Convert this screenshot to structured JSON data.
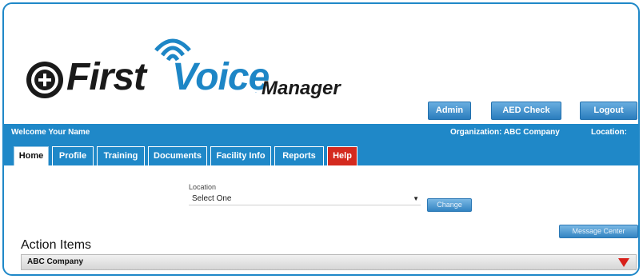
{
  "logo": {
    "first": "First",
    "voice": "Voice",
    "tm": ".",
    "manager": "Manager"
  },
  "header_buttons": {
    "admin": "Admin",
    "aed_check": "AED Check",
    "logout": "Logout"
  },
  "status_bar": {
    "welcome": "Welcome Your Name",
    "organization": "Organization: ABC Company",
    "location": "Location: All"
  },
  "tabs": [
    {
      "label": "Home"
    },
    {
      "label": "Profile"
    },
    {
      "label": "Training"
    },
    {
      "label": "Documents"
    },
    {
      "label": "Facility Info"
    },
    {
      "label": "Reports"
    },
    {
      "label": "Help"
    }
  ],
  "location_filter": {
    "label": "Location",
    "selected": "Select One",
    "change_button": "Change"
  },
  "message_center_button": "Message Center",
  "action_items": {
    "title": "Action Items",
    "company": "ABC Company"
  },
  "colors": {
    "brand_blue": "#1f88c8",
    "help_red": "#d42a1f",
    "expand_arrow": "#d8201a"
  }
}
